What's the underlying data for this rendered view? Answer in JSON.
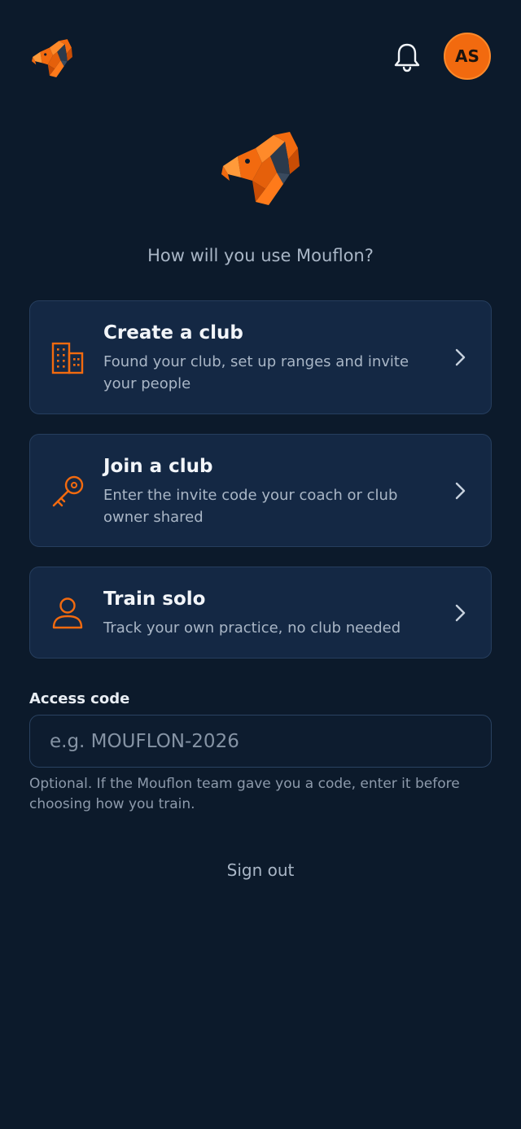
{
  "header": {
    "logo_icon": "ram-logo-icon",
    "bell_icon": "bell-icon",
    "avatar_initials": "AS"
  },
  "hero": {
    "logo_icon": "ram-logo-icon",
    "question": "How will you use Mouflon?"
  },
  "options": [
    {
      "icon": "building-icon",
      "title": "Create a club",
      "description": "Found your club, set up ranges and invite your people"
    },
    {
      "icon": "key-icon",
      "title": "Join a club",
      "description": "Enter the invite code your coach or club owner shared"
    },
    {
      "icon": "user-icon",
      "title": "Train solo",
      "description": "Track your own practice, no club needed"
    }
  ],
  "access_code": {
    "label": "Access code",
    "placeholder": "e.g. MOUFLON-2026",
    "value": "",
    "help": "Optional. If the Mouflon team gave you a code, enter it before choosing how you train."
  },
  "sign_out_label": "Sign out",
  "colors": {
    "background": "#0c1a2b",
    "card": "#142844",
    "accent": "#f26a0f"
  }
}
